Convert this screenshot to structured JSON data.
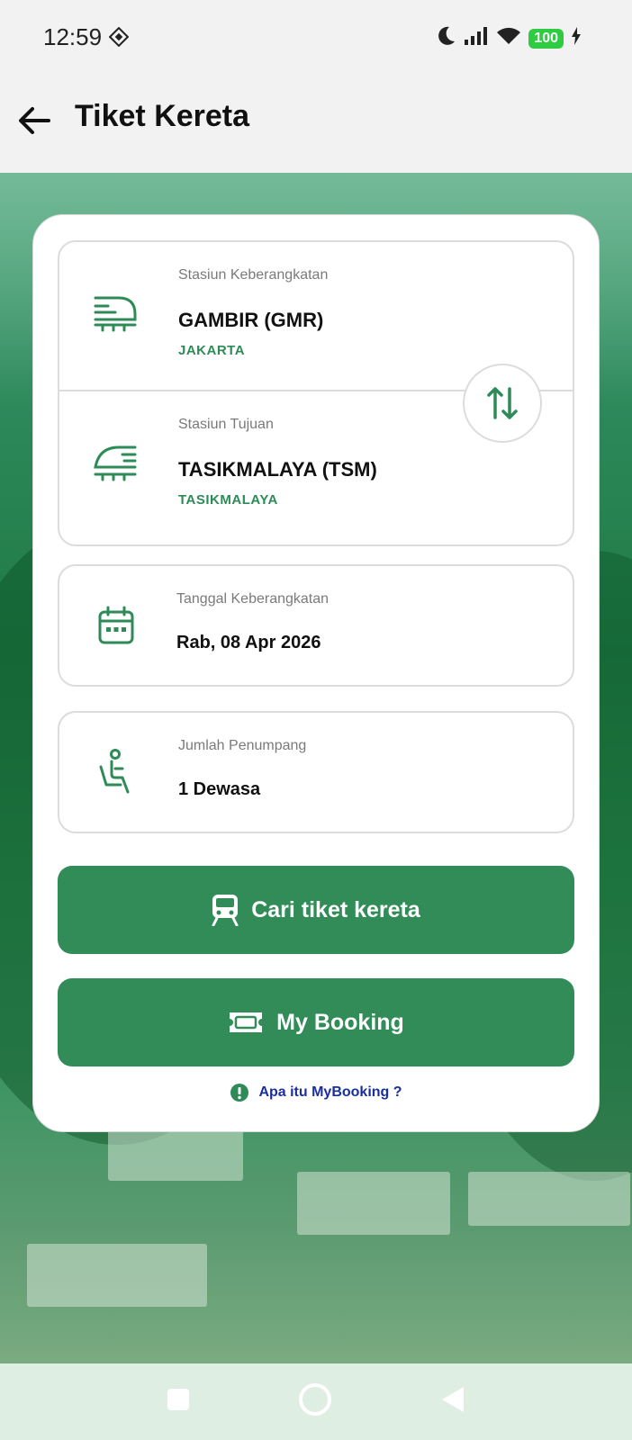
{
  "status_bar": {
    "time": "12:59",
    "battery": "100"
  },
  "app_bar": {
    "title": "Tiket Kereta"
  },
  "origin": {
    "label": "Stasiun Keberangkatan",
    "station": "GAMBIR (GMR)",
    "city": "JAKARTA"
  },
  "destination": {
    "label": "Stasiun Tujuan",
    "station": "TASIKMALAYA (TSM)",
    "city": "TASIKMALAYA"
  },
  "date": {
    "label": "Tanggal Keberangkatan",
    "value": "Rab, 08 Apr 2026"
  },
  "passengers": {
    "label": "Jumlah Penumpang",
    "value": "1 Dewasa"
  },
  "buttons": {
    "search": "Cari tiket kereta",
    "booking": "My Booking"
  },
  "info_link": "Apa itu MyBooking ?",
  "colors": {
    "primary": "#318c58",
    "accent_text": "#2e8b57",
    "link": "#1a2f9e"
  },
  "icons": {
    "back": "arrow-left-icon",
    "origin": "train-icon",
    "destination": "train-bullet-icon",
    "swap": "swap-vertical-icon",
    "date": "calendar-icon",
    "passengers": "seat-person-icon",
    "search": "train-front-icon",
    "booking": "ticket-icon",
    "info": "info-icon"
  }
}
